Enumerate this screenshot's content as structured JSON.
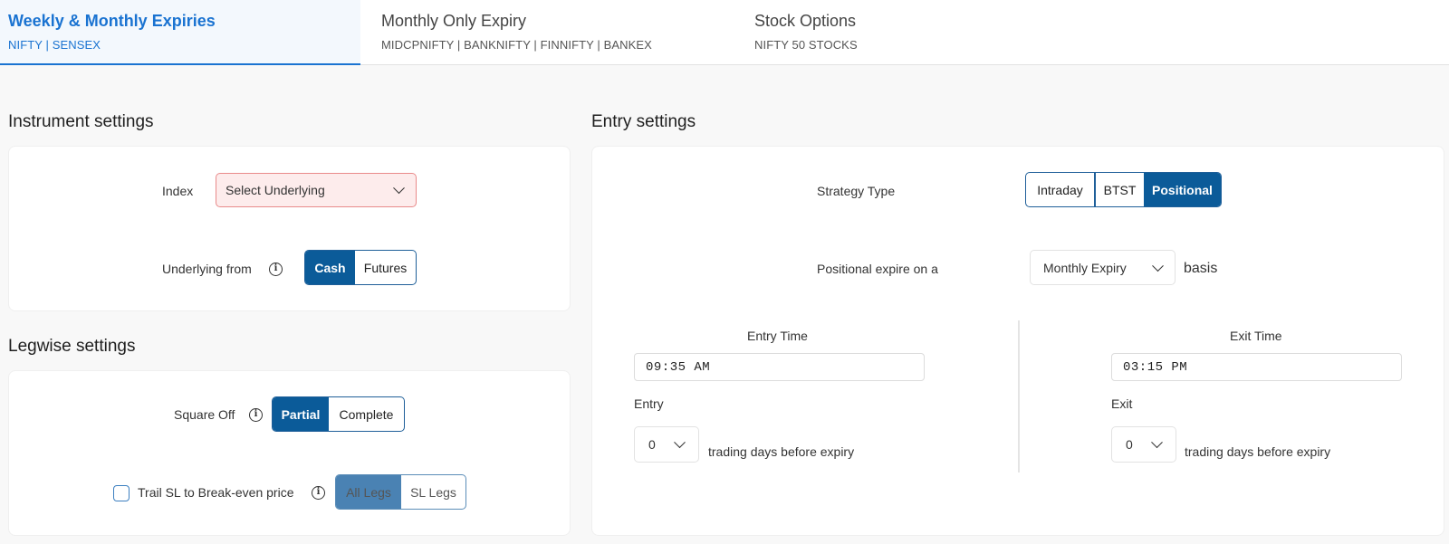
{
  "tabs": [
    {
      "title": "Weekly & Monthly Expiries",
      "subtitle": "NIFTY | SENSEX",
      "active": true
    },
    {
      "title": "Monthly Only Expiry",
      "subtitle": "MIDCPNIFTY | BANKNIFTY | FINNIFTY | BANKEX",
      "active": false
    },
    {
      "title": "Stock Options",
      "subtitle": "NIFTY 50 STOCKS",
      "active": false
    }
  ],
  "instrument": {
    "title": "Instrument settings",
    "index_label": "Index",
    "index_select": {
      "value": "Select Underlying",
      "state": "error"
    },
    "underlying_label": "Underlying from",
    "underlying_options": [
      "Cash",
      "Futures"
    ],
    "underlying_selected": "Cash"
  },
  "legwise": {
    "title": "Legwise settings",
    "square_off_label": "Square Off",
    "square_off_options": [
      "Partial",
      "Complete"
    ],
    "square_off_selected": "Partial",
    "trail_label": "Trail SL to Break-even price",
    "trail_checked": false,
    "trail_options": [
      "All Legs",
      "SL Legs"
    ],
    "trail_selected": "All Legs"
  },
  "entry": {
    "title": "Entry settings",
    "strategy_label": "Strategy Type",
    "strategy_options": [
      "Intraday",
      "BTST",
      "Positional"
    ],
    "strategy_selected": "Positional",
    "positional_label": "Positional expire on a",
    "positional_select": "Monthly Expiry",
    "positional_suffix": "basis",
    "entry_time_label": "Entry Time",
    "entry_time": "09:35 AM",
    "entry_days_label": "Entry",
    "entry_days": "0",
    "entry_days_suffix": "trading days before expiry",
    "exit_time_label": "Exit Time",
    "exit_time": "03:15 PM",
    "exit_days_label": "Exit",
    "exit_days": "0",
    "exit_days_suffix": "trading days before expiry"
  },
  "colors": {
    "accent": "#1a73d1",
    "selected": "#0b5b99",
    "selected_muted": "#4a82b3",
    "error_bg": "#fdecec",
    "error_border": "#e98a8a"
  }
}
